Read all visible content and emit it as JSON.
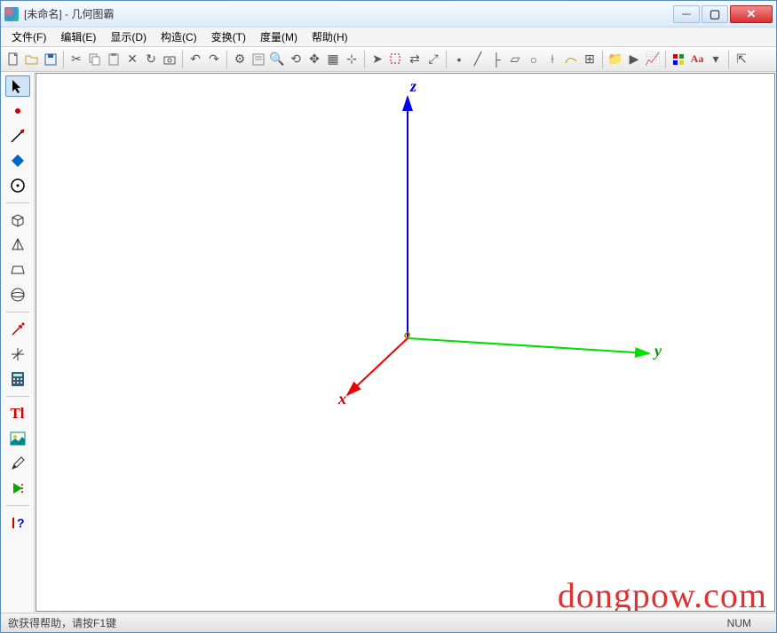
{
  "window": {
    "title": "[未命名] - 几何图霸"
  },
  "menu": {
    "file": "文件(F)",
    "edit": "编辑(E)",
    "view": "显示(D)",
    "construct": "构造(C)",
    "transform": "变换(T)",
    "measure": "度量(M)",
    "help": "帮助(H)"
  },
  "axis": {
    "origin": "o",
    "x": "x",
    "y": "y",
    "z": "z"
  },
  "status": {
    "help": "欲获得帮助，请按F1键",
    "num": "NUM"
  },
  "palette": {
    "text_tool": "Tl",
    "help_tool": "?"
  },
  "toolbar": {
    "aa": "Aa"
  },
  "watermark": "dongpow.com"
}
